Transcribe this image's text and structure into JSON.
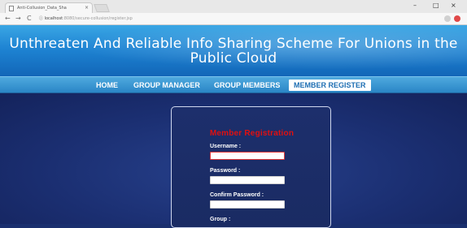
{
  "browser": {
    "tab_title": "Anti-Collusion_Data_Sha",
    "tab_close": "×",
    "url_host": "localhost",
    "url_path": ":8080/secure-collusion/register.jsp",
    "window_controls": [
      "–",
      "□",
      "×"
    ],
    "back": "←",
    "forward": "→",
    "reload": "C",
    "info": "ⓘ"
  },
  "header": {
    "site_title": "Unthreaten And Reliable Info Sharing Scheme For Unions in the Public Cloud"
  },
  "nav": {
    "items": [
      {
        "label": "HOME"
      },
      {
        "label": "GROUP MANAGER"
      },
      {
        "label": "GROUP MEMBERS"
      },
      {
        "label": "MEMBER REGISTER"
      }
    ],
    "active_index": 3
  },
  "form": {
    "title": "Member Registration",
    "username_label": "Username :",
    "password_label": "Password :",
    "confirm_label": "Confirm Password :",
    "group_label": "Group :",
    "username_value": "",
    "password_value": "",
    "confirm_value": ""
  },
  "colors": {
    "accent": "#1e84d3",
    "form_title": "#e01010",
    "page_bg": "#1b2f72"
  }
}
